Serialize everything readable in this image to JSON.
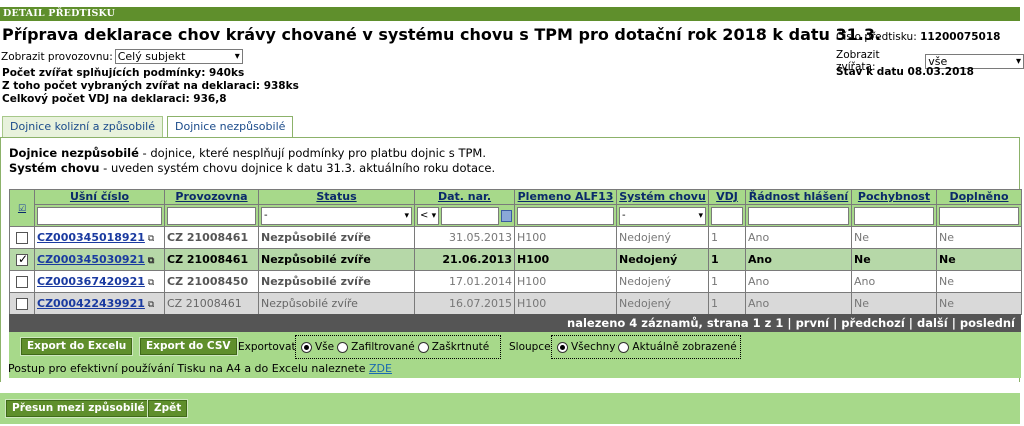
{
  "header": {
    "bar_title": "DETAIL PŘEDTISKU",
    "title": "Příprava deklarace chov krávy chované v systému chovu s TPM pro dotační rok 2018 k datu 31.3.",
    "provoz_label": "Zobrazit provozovnu:",
    "provoz_value": "Celý subjekt",
    "count_met": "Počet zvířat splňujících podmínky: 940ks",
    "count_selected": "Z toho počet vybraných zvířat na deklaraci: 938ks",
    "vdj_total": "Celkový počet VDJ na deklaraci: 936,8",
    "pretisk_label": "Číslo předtisku:",
    "pretisk_number": "11200075018",
    "animals_label": "Zobrazit zvířata:",
    "animals_value": "vše",
    "state_date": "Stav k datu 08.03.2018"
  },
  "tabs": [
    {
      "label": "Dojnice kolizní a způsobilé"
    },
    {
      "label": "Dojnice nezpůsobilé"
    }
  ],
  "description": {
    "line1_term": "Dojnice nezpůsobilé",
    "line1_text": " - dojnice, které nesplňují podmínky pro platbu dojnic s TPM.",
    "line2_term": "Systém chovu",
    "line2_text": " - uveden systém chovu dojnice k datu 31.3. aktuálního roku dotace."
  },
  "table": {
    "columns": [
      "Ušní číslo",
      "Provozovna",
      "Status",
      "Dat. nar.",
      "Plemeno ALF13",
      "Systém chovu",
      "VDJ",
      "Řádnost hlášení",
      "Pochybnost",
      "Doplněno"
    ],
    "filters": {
      "status": "-",
      "date_op": "<",
      "system": "-"
    },
    "rows": [
      {
        "ear": "CZ000345018921",
        "provoz": "CZ 21008461",
        "status": "Nezpůsobilé zvíře",
        "date": "31.05.2013",
        "breed": "H100",
        "system": "Nedojený",
        "vdj": "1",
        "radnost": "Ano",
        "pochyb": "Ne",
        "dopl": "Ne",
        "checked": false
      },
      {
        "ear": "CZ000345030921",
        "provoz": "CZ 21008461",
        "status": "Nezpůsobilé zvíře",
        "date": "21.06.2013",
        "breed": "H100",
        "system": "Nedojený",
        "vdj": "1",
        "radnost": "Ano",
        "pochyb": "Ne",
        "dopl": "Ne",
        "checked": true
      },
      {
        "ear": "CZ000367420921",
        "provoz": "CZ 21008450",
        "status": "Nezpůsobilé zvíře",
        "date": "17.01.2014",
        "breed": "H100",
        "system": "Nedojený",
        "vdj": "1",
        "radnost": "Ano",
        "pochyb": "Ano",
        "dopl": "Ne",
        "checked": false
      },
      {
        "ear": "CZ000422439921",
        "provoz": "CZ 21008461",
        "status": "Nezpůsobilé zvíře",
        "date": "16.07.2015",
        "breed": "H100",
        "system": "Nedojený",
        "vdj": "1",
        "radnost": "Ano",
        "pochyb": "Ne",
        "dopl": "Ne",
        "checked": false
      }
    ]
  },
  "pager": {
    "text": "nalezeno 4 záznamů, strana 1 z 1 | první | předchozí | další | poslední"
  },
  "export": {
    "excel_button": "Export do Excelu",
    "csv_button": "Export do CSV",
    "export_label": "Exportovat",
    "opt_all": "Vše",
    "opt_filtered": "Zafiltrované",
    "opt_checked": "Zaškrtnuté",
    "columns_label": "Sloupce",
    "col_all": "Všechny",
    "col_shown": "Aktuálně zobrazené",
    "help_text": "Postup pro efektivní používání Tisku na A4 a do Excelu naleznete ",
    "help_link": "ZDE"
  },
  "bottom": {
    "move_button": "Přesun mezi způsobilé",
    "back_button": "Zpět"
  }
}
